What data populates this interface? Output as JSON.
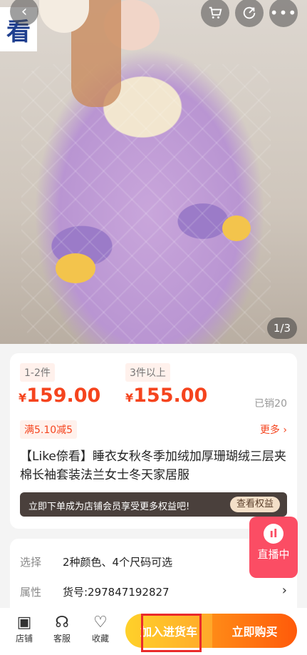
{
  "hero": {
    "logo_text": "看",
    "image_counter": "1/3",
    "icons": [
      "chevron-left-icon",
      "cart-icon",
      "share-icon",
      "more-icon"
    ]
  },
  "pricing": {
    "tiers": [
      {
        "range": "1-2件",
        "currency": "¥",
        "price": "159.00"
      },
      {
        "range": "3件以上",
        "currency": "¥",
        "price": "155.00"
      }
    ],
    "sold": "已销20",
    "promo": "满5.10减5",
    "more": "更多"
  },
  "product": {
    "title": "【Like倷看】睡衣女秋冬季加绒加厚珊瑚绒三层夹棉长袖套装法兰女士冬天家居服"
  },
  "member_bar": {
    "text": "立即下单成为店铺会员享受更多权益吧!",
    "button": "查看权益"
  },
  "specs": [
    {
      "label": "选择",
      "value": "2种颜色、4个尺码可选"
    },
    {
      "label": "属性",
      "value": "货号:297847192827"
    }
  ],
  "live": {
    "label": "直播中"
  },
  "bottom_bar": {
    "store": "店铺",
    "service": "客服",
    "favorite": "收藏",
    "add_to_cart": "加入进货车",
    "buy_now": "立即购买"
  },
  "colors": {
    "accent": "#f5441e",
    "live": "#fb4d64",
    "cart_yellow": "#ffd12a",
    "buy_orange": "#ff6a10",
    "highlight": "#ea2b2b"
  }
}
